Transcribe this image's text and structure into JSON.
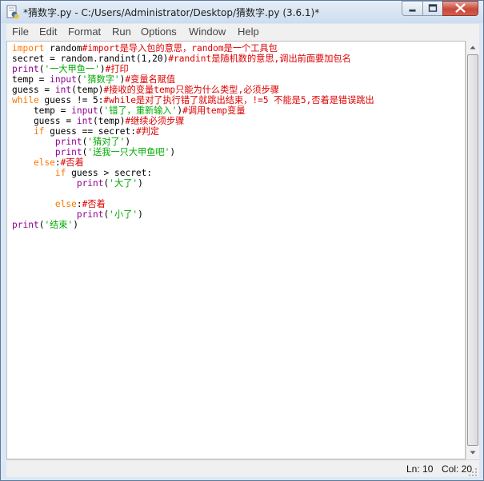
{
  "window": {
    "title": "*猜数字.py - C:/Users/Administrator/Desktop/猜数字.py (3.6.1)*",
    "icon": "idle-python-icon",
    "controls": [
      "minimize-icon",
      "maximize-icon",
      "close-icon"
    ]
  },
  "menu": {
    "items": [
      "File",
      "Edit",
      "Format",
      "Run",
      "Options",
      "Window",
      "Help"
    ]
  },
  "code": {
    "lines": [
      [
        {
          "t": "import",
          "c": "kw"
        },
        {
          "t": " random",
          "c": ""
        },
        {
          "t": "#import是导入包的意思，random是一个工具包",
          "c": "cmt"
        }
      ],
      [
        {
          "t": "secret = random.randint(1,20)",
          "c": ""
        },
        {
          "t": "#randint是随机数的意思,调出前面要加包名",
          "c": "cmt"
        }
      ],
      [
        {
          "t": "print",
          "c": "bi"
        },
        {
          "t": "(",
          "c": ""
        },
        {
          "t": "'一大甲鱼一'",
          "c": "str"
        },
        {
          "t": ")",
          "c": ""
        },
        {
          "t": "#打印",
          "c": "cmt"
        }
      ],
      [
        {
          "t": "temp = ",
          "c": ""
        },
        {
          "t": "input",
          "c": "bi"
        },
        {
          "t": "(",
          "c": ""
        },
        {
          "t": "'猜数字'",
          "c": "str"
        },
        {
          "t": ")",
          "c": ""
        },
        {
          "t": "#变量名赋值",
          "c": "cmt"
        }
      ],
      [
        {
          "t": "guess = ",
          "c": ""
        },
        {
          "t": "int",
          "c": "bi"
        },
        {
          "t": "(temp)",
          "c": ""
        },
        {
          "t": "#接收的变量temp只能为什么类型,必须步骤",
          "c": "cmt"
        }
      ],
      [
        {
          "t": "while",
          "c": "kw"
        },
        {
          "t": " guess != 5:",
          "c": ""
        },
        {
          "t": "#while是对了执行错了就跳出结束，!=5 不能是5,否着是错误跳出",
          "c": "cmt"
        }
      ],
      [
        {
          "t": "    temp = ",
          "c": ""
        },
        {
          "t": "input",
          "c": "bi"
        },
        {
          "t": "(",
          "c": ""
        },
        {
          "t": "'错了，重新输入'",
          "c": "str"
        },
        {
          "t": ")",
          "c": ""
        },
        {
          "t": "#调用temp变量",
          "c": "cmt"
        }
      ],
      [
        {
          "t": "    guess = ",
          "c": ""
        },
        {
          "t": "int",
          "c": "bi"
        },
        {
          "t": "(temp)",
          "c": ""
        },
        {
          "t": "#继续必须步骤",
          "c": "cmt"
        }
      ],
      [
        {
          "t": "    ",
          "c": ""
        },
        {
          "t": "if",
          "c": "kw"
        },
        {
          "t": " guess == secret:",
          "c": ""
        },
        {
          "t": "#判定",
          "c": "cmt"
        }
      ],
      [
        {
          "t": "        ",
          "c": ""
        },
        {
          "t": "print",
          "c": "bi"
        },
        {
          "t": "(",
          "c": ""
        },
        {
          "t": "'猜对了'",
          "c": "str"
        },
        {
          "t": ")",
          "c": ""
        }
      ],
      [
        {
          "t": "        ",
          "c": ""
        },
        {
          "t": "print",
          "c": "bi"
        },
        {
          "t": "(",
          "c": ""
        },
        {
          "t": "'送我一只大甲鱼吧'",
          "c": "str"
        },
        {
          "t": ")",
          "c": ""
        }
      ],
      [
        {
          "t": "    ",
          "c": ""
        },
        {
          "t": "else",
          "c": "kw"
        },
        {
          "t": ":",
          "c": ""
        },
        {
          "t": "#否着",
          "c": "cmt"
        }
      ],
      [
        {
          "t": "        ",
          "c": ""
        },
        {
          "t": "if",
          "c": "kw"
        },
        {
          "t": " guess > secret:",
          "c": ""
        }
      ],
      [
        {
          "t": "            ",
          "c": ""
        },
        {
          "t": "print",
          "c": "bi"
        },
        {
          "t": "(",
          "c": ""
        },
        {
          "t": "'大了'",
          "c": "str"
        },
        {
          "t": ")",
          "c": ""
        }
      ],
      [],
      [
        {
          "t": "        ",
          "c": ""
        },
        {
          "t": "else",
          "c": "kw"
        },
        {
          "t": ":",
          "c": ""
        },
        {
          "t": "#否着",
          "c": "cmt"
        }
      ],
      [
        {
          "t": "            ",
          "c": ""
        },
        {
          "t": "print",
          "c": "bi"
        },
        {
          "t": "(",
          "c": ""
        },
        {
          "t": "'小了'",
          "c": "str"
        },
        {
          "t": ")",
          "c": ""
        }
      ],
      [
        {
          "t": "print",
          "c": "bi"
        },
        {
          "t": "(",
          "c": ""
        },
        {
          "t": "'结束'",
          "c": "str"
        },
        {
          "t": ")",
          "c": ""
        }
      ]
    ]
  },
  "status": {
    "line": "Ln: 10",
    "col": "Col: 20"
  }
}
